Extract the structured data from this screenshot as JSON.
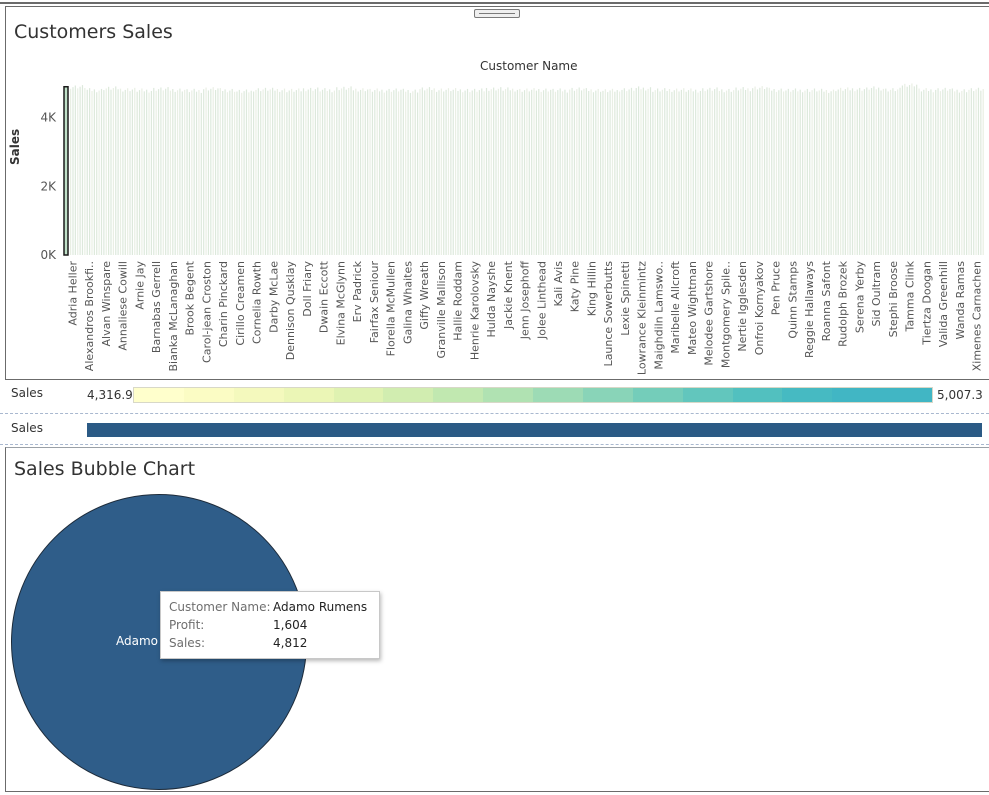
{
  "chart_data": [
    {
      "type": "bar",
      "title": "Customers Sales",
      "column_header": "Customer Name",
      "ylabel": "Sales",
      "ylim": [
        0,
        5300
      ],
      "yticks": [
        "0K",
        "2K",
        "4K"
      ],
      "yticks_values": [
        0,
        2000,
        4000
      ],
      "categories": [
        "Adria Heller",
        "Alexandros Brookfi..",
        "Alvan Winspare",
        "Annaliese Cowill",
        "Arnie Jay",
        "Barnabas Gerrell",
        "Bianka McLanaghan",
        "Brook Begent",
        "Carol-jean Croston",
        "Charin Pinckard",
        "Cirillo Creamen",
        "Cornelia Rowth",
        "Darby McLae",
        "Dennison Qusklay",
        "Doll Friary",
        "Dwain Eccott",
        "Elvina McGlynn",
        "Erv Padrick",
        "Fairfax Seniour",
        "Florella McMullen",
        "Galina Whaites",
        "Giffy Wreath",
        "Granville Mallison",
        "Hallie Roddam",
        "Henrie Karolovsky",
        "Hulda Nayshe",
        "Jackie Knent",
        "Jenn Josephoff",
        "Jolee Linthead",
        "Kali Avis",
        "Katy Pine",
        "King Hillin",
        "Launce Sowerbutts",
        "Lexie Spinetti",
        "Lowrance Kleinmintz",
        "Maighdiln Lamswo..",
        "Maribelle Allcroft",
        "Mateo Wightman",
        "Melodee Gartshore",
        "Montgomery Spile..",
        "Nertie Igglesden",
        "Onfroi Kornyakov",
        "Pen Pruce",
        "Quinn Stamps",
        "Reggie Hallaways",
        "Roanna Safont",
        "Rudolph Brozek",
        "Serena Yerby",
        "Sid Oultram",
        "Stephi Broose",
        "Tamma Clink",
        "Tiertza Doogan",
        "Valida Greenhill",
        "Wanda Ramas",
        "Ximenes Carnachen"
      ],
      "values": [
        4900,
        4800,
        4850,
        4820,
        4790,
        4830,
        4810,
        4780,
        4840,
        4800,
        4760,
        4820,
        4810,
        4790,
        4830,
        4800,
        4850,
        4820,
        4790,
        4800,
        4780,
        4830,
        4810,
        4800,
        4790,
        4840,
        4820,
        4800,
        4810,
        4790,
        4830,
        4800,
        4780,
        4820,
        4850,
        4800,
        4810,
        4790,
        4820,
        4800,
        4830,
        4870,
        4810,
        4790,
        4800,
        4780,
        4820,
        4830,
        4850,
        4810,
        4960,
        4800,
        4820,
        4790,
        4810
      ],
      "highlighted": "Adria Heller",
      "color_legend": {
        "label": "Sales",
        "min_label": "4,316.9",
        "max_label": "5,007.3",
        "min": 4316.9,
        "max": 5007.3
      }
    },
    {
      "type": "scatter",
      "title": "Sales Bubble Chart",
      "size_legend_label": "Sales",
      "bubble": {
        "customer": "Adamo Rumens",
        "profit": 1604,
        "sales": 4812,
        "label_text": "Adamo R"
      }
    }
  ],
  "tooltip": {
    "customer_key": "Customer Name:",
    "customer_value": "Adamo Rumens",
    "profit_key": "Profit:",
    "profit_value": "1,604",
    "sales_key": "Sales:",
    "sales_value": "4,812"
  },
  "colors": {
    "bar_fill": "#dde9dc",
    "highlight_border": "#1a1a1a",
    "highlight_fill": "#bfe0c8",
    "bubble": "#2f5d89",
    "ramp_start": "#ffffcc",
    "ramp_end": "#41b6c4",
    "size_bar": "#2b5a85"
  }
}
